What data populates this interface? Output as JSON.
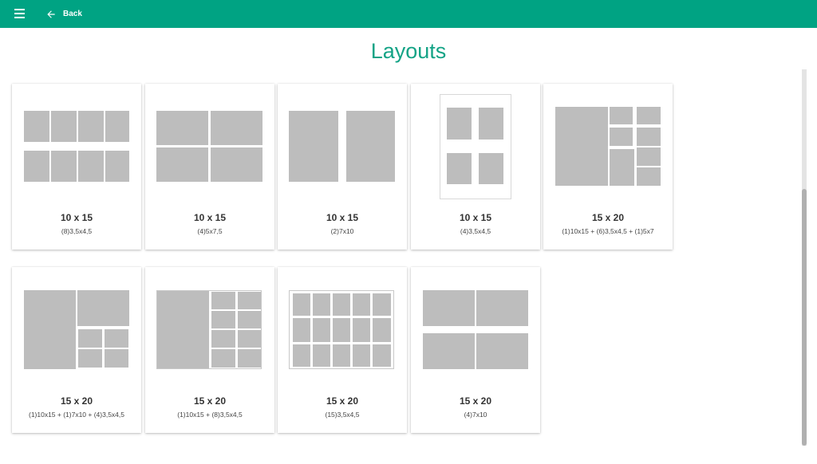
{
  "topbar": {
    "menu_icon": "menu-icon",
    "back_icon": "arrow-left-icon",
    "back_label": "Back",
    "color": "#00a383"
  },
  "page": {
    "title": "Layouts"
  },
  "colors": {
    "slot": "#bdbdbd",
    "paper": "#ffffff",
    "accent": "#14a386"
  },
  "layouts": [
    {
      "size": "10 x 15",
      "description": "(8)3,5x4,5"
    },
    {
      "size": "10 x 15",
      "description": "(4)5x7,5"
    },
    {
      "size": "10 x 15",
      "description": "(2)7x10"
    },
    {
      "size": "10 x 15",
      "description": "(4)3,5x4,5"
    },
    {
      "size": "15 x 20",
      "description": "(1)10x15 + (6)3,5x4,5 + (1)5x7"
    },
    {
      "size": "15 x 20",
      "description": "(1)10x15 + (1)7x10 + (4)3,5x4,5"
    },
    {
      "size": "15 x 20",
      "description": "(1)10x15 + (8)3,5x4,5"
    },
    {
      "size": "15 x 20",
      "description": "(15)3,5x4,5"
    },
    {
      "size": "15 x 20",
      "description": "(4)7x10"
    }
  ]
}
